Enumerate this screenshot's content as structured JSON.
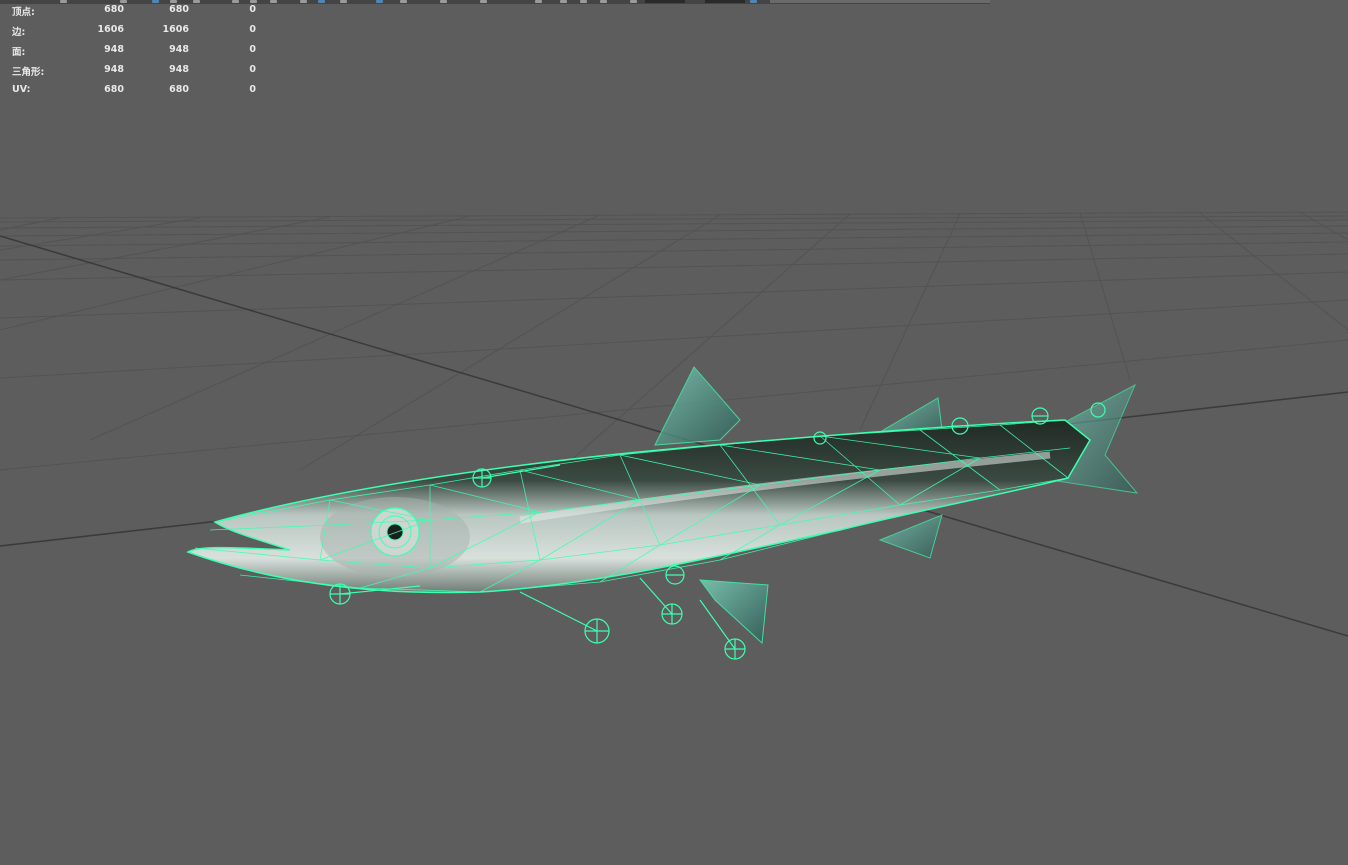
{
  "hud": {
    "rows": [
      {
        "label": "顶点:",
        "values": [
          "680",
          "680",
          "0"
        ]
      },
      {
        "label": "边:",
        "values": [
          "1606",
          "1606",
          "0"
        ]
      },
      {
        "label": "面:",
        "values": [
          "948",
          "948",
          "0"
        ]
      },
      {
        "label": "三角形:",
        "values": [
          "948",
          "948",
          "0"
        ]
      },
      {
        "label": "UV:",
        "values": [
          "680",
          "680",
          "0"
        ]
      }
    ]
  },
  "colors": {
    "background": "#5d5d5d",
    "grid": "#4f4f4f",
    "axis": "#3a3a3a",
    "wireframe": "#3dffb0",
    "hud_text": "#e8e8e8",
    "toolbar_active": "#4f86b8"
  },
  "viewport": {
    "object": "fish-mesh",
    "display_mode": "wireframe-on-shaded",
    "selected": true
  }
}
